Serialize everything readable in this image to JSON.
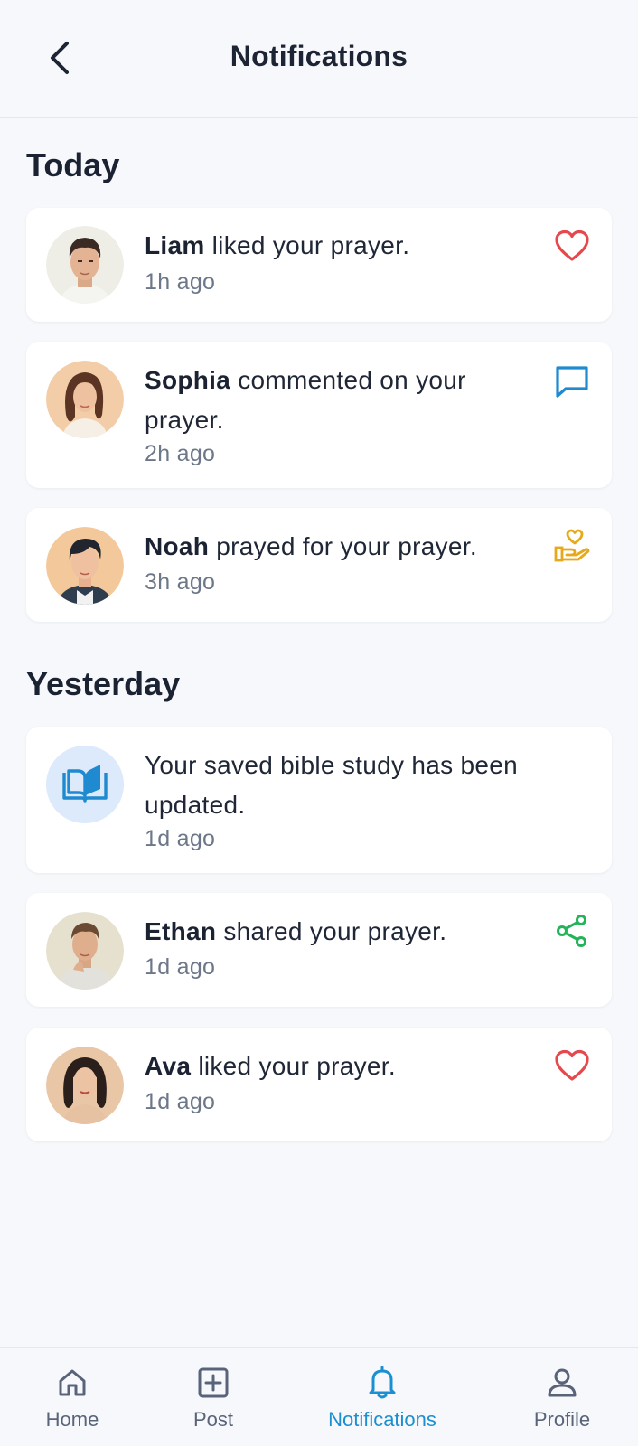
{
  "header": {
    "title": "Notifications"
  },
  "sections": {
    "today": "Today",
    "yesterday": "Yesterday"
  },
  "notifications": [
    {
      "name": "Liam",
      "text": "liked your prayer.",
      "time": "1h ago",
      "icon": "heart-icon",
      "color": "#e5484d"
    },
    {
      "name": "Sophia",
      "text": "commented on your prayer.",
      "time": "2h ago",
      "icon": "comment-icon",
      "color": "#1f8ad0"
    },
    {
      "name": "Noah",
      "text": "prayed for your prayer.",
      "time": "3h ago",
      "icon": "praying-hand-heart-icon",
      "color": "#e7a91a"
    },
    {
      "name": "",
      "text": "Your saved bible study has been updated.",
      "time": "1d ago",
      "icon": "open-book-icon",
      "color": "#1f8ad0"
    },
    {
      "name": "Ethan",
      "text": "shared your prayer.",
      "time": "1d ago",
      "icon": "share-icon",
      "color": "#23b45a"
    },
    {
      "name": "Ava",
      "text": "liked your prayer.",
      "time": "1d ago",
      "icon": "heart-icon",
      "color": "#e5484d"
    }
  ],
  "nav": [
    {
      "label": "Home",
      "icon": "home-icon"
    },
    {
      "label": "Post",
      "icon": "plus-square-icon"
    },
    {
      "label": "Notifications",
      "icon": "bell-icon",
      "active": true
    },
    {
      "label": "Profile",
      "icon": "user-icon"
    }
  ],
  "colors": {
    "accent": "#1b8fd1",
    "background": "#f6f8fb",
    "card": "#ffffff",
    "text_primary": "#1b2232",
    "text_secondary": "#6c7789"
  }
}
